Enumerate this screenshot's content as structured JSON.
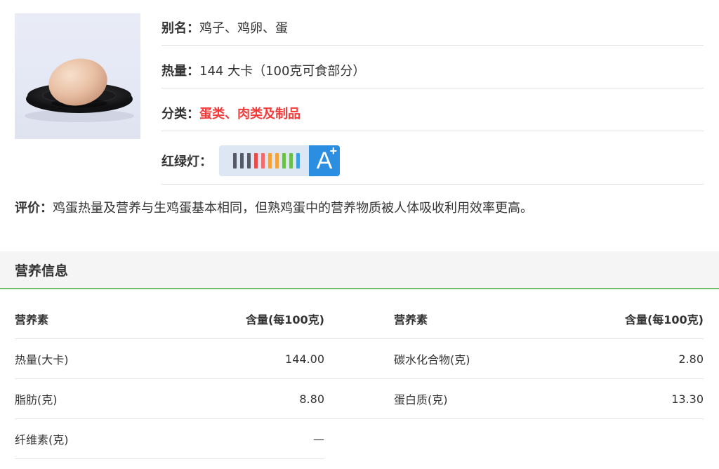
{
  "food": {
    "alias_label": "别名：",
    "alias_value": "鸡子、鸡卵、蛋",
    "calorie_label": "热量：",
    "calorie_value": "144 大卡（100克可食部分）",
    "category_label": "分类：",
    "category_value": "蛋类、肉类及制品",
    "traffic_light_label": "红绿灯：",
    "traffic_light_grade": "A",
    "traffic_light_grade_suffix": "+",
    "traffic_light_colors": [
      "#555a66",
      "#555a66",
      "#555a66",
      "#e94b4b",
      "#f36b6b",
      "#f3a23c",
      "#f3a23c",
      "#6bbf4a",
      "#6bbf4a",
      "#3c9fe0"
    ],
    "evaluation_label": "评价：",
    "evaluation_text": "鸡蛋热量及营养与生鸡蛋基本相同，但熟鸡蛋中的营养物质被人体吸收利用效率更高。"
  },
  "nutrition": {
    "section_title": "营养信息",
    "col_nutrient": "营养素",
    "col_amount": "含量(每100克)",
    "rows": [
      {
        "name1": "热量(大卡)",
        "value1": "144.00",
        "name2": "碳水化合物(克)",
        "value2": "2.80"
      },
      {
        "name1": "脂肪(克)",
        "value1": "8.80",
        "name2": "蛋白质(克)",
        "value2": "13.30"
      },
      {
        "name1": "纤维素(克)",
        "value1": "—",
        "name2": "",
        "value2": ""
      }
    ]
  },
  "colors": {
    "accent_green": "#6cc06c",
    "category_red": "#f23c3c",
    "grade_blue": "#2b8ee0"
  }
}
